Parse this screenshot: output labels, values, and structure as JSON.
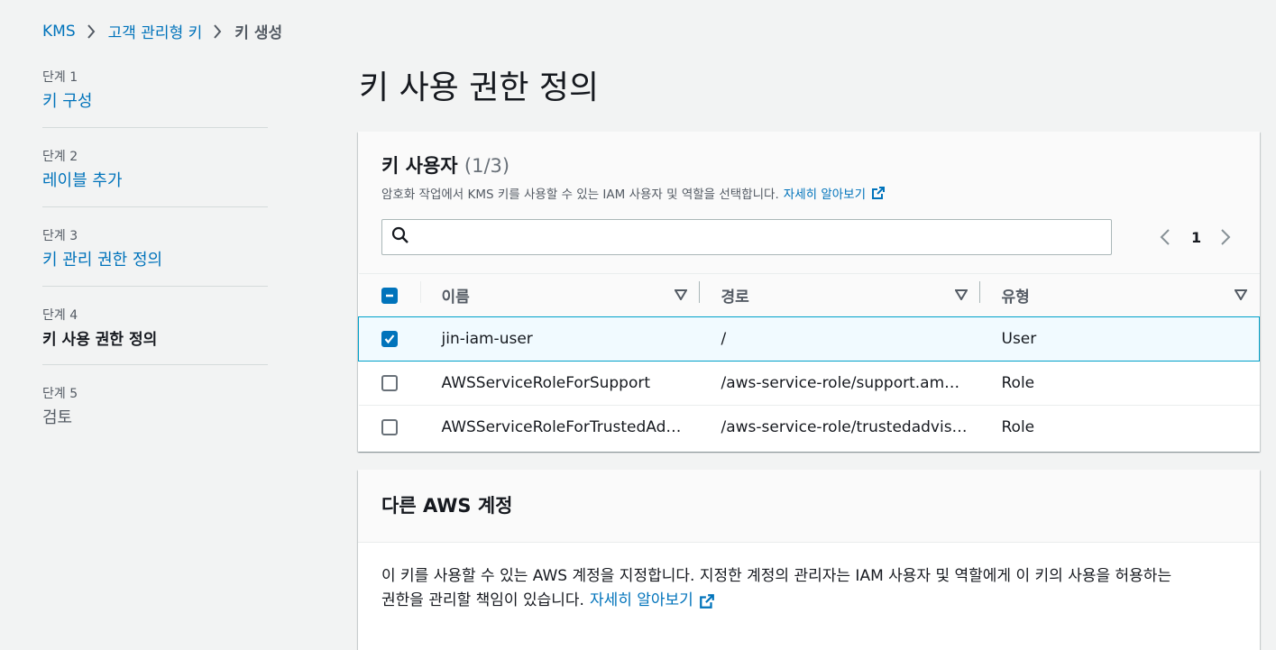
{
  "breadcrumb": {
    "items": [
      "KMS",
      "고객 관리형 키"
    ],
    "current": "키 생성"
  },
  "steps": [
    {
      "num": "단계 1",
      "title": "키 구성"
    },
    {
      "num": "단계 2",
      "title": "레이블 추가"
    },
    {
      "num": "단계 3",
      "title": "키 관리 권한 정의"
    },
    {
      "num": "단계 4",
      "title": "키 사용 권한 정의"
    },
    {
      "num": "단계 5",
      "title": "검토"
    }
  ],
  "page_title": "키 사용 권한 정의",
  "key_users": {
    "title": "키 사용자",
    "count": "(1/3)",
    "description": "암호화 작업에서 KMS 키를 사용할 수 있는 IAM 사용자 및 역할을 선택합니다.",
    "learn_more": "자세히 알아보기",
    "search_value": "",
    "page": "1",
    "columns": [
      "이름",
      "경로",
      "유형"
    ],
    "rows": [
      {
        "name": "jin-iam-user",
        "path": "/",
        "type": "User",
        "selected": true
      },
      {
        "name": "AWSServiceRoleForSupport",
        "path": "/aws-service-role/support.am…",
        "type": "Role",
        "selected": false
      },
      {
        "name": "AWSServiceRoleForTrustedAd…",
        "path": "/aws-service-role/trustedadvis…",
        "type": "Role",
        "selected": false
      }
    ]
  },
  "other_accounts": {
    "title": "다른 AWS 계정",
    "body_line1": "이 키를 사용할 수 있는 AWS 계정을 지정합니다. 지정한 계정의 관리자는 IAM 사용자 및 역할에게 이 키의 사용을 허용하는",
    "body_line2": "권한을 관리할 책임이 있습니다.",
    "learn_more": "자세히 알아보기"
  },
  "colors": {
    "link": "#0073bb",
    "selected_row_bg": "#f1faff",
    "selected_border": "#00a1c9"
  }
}
